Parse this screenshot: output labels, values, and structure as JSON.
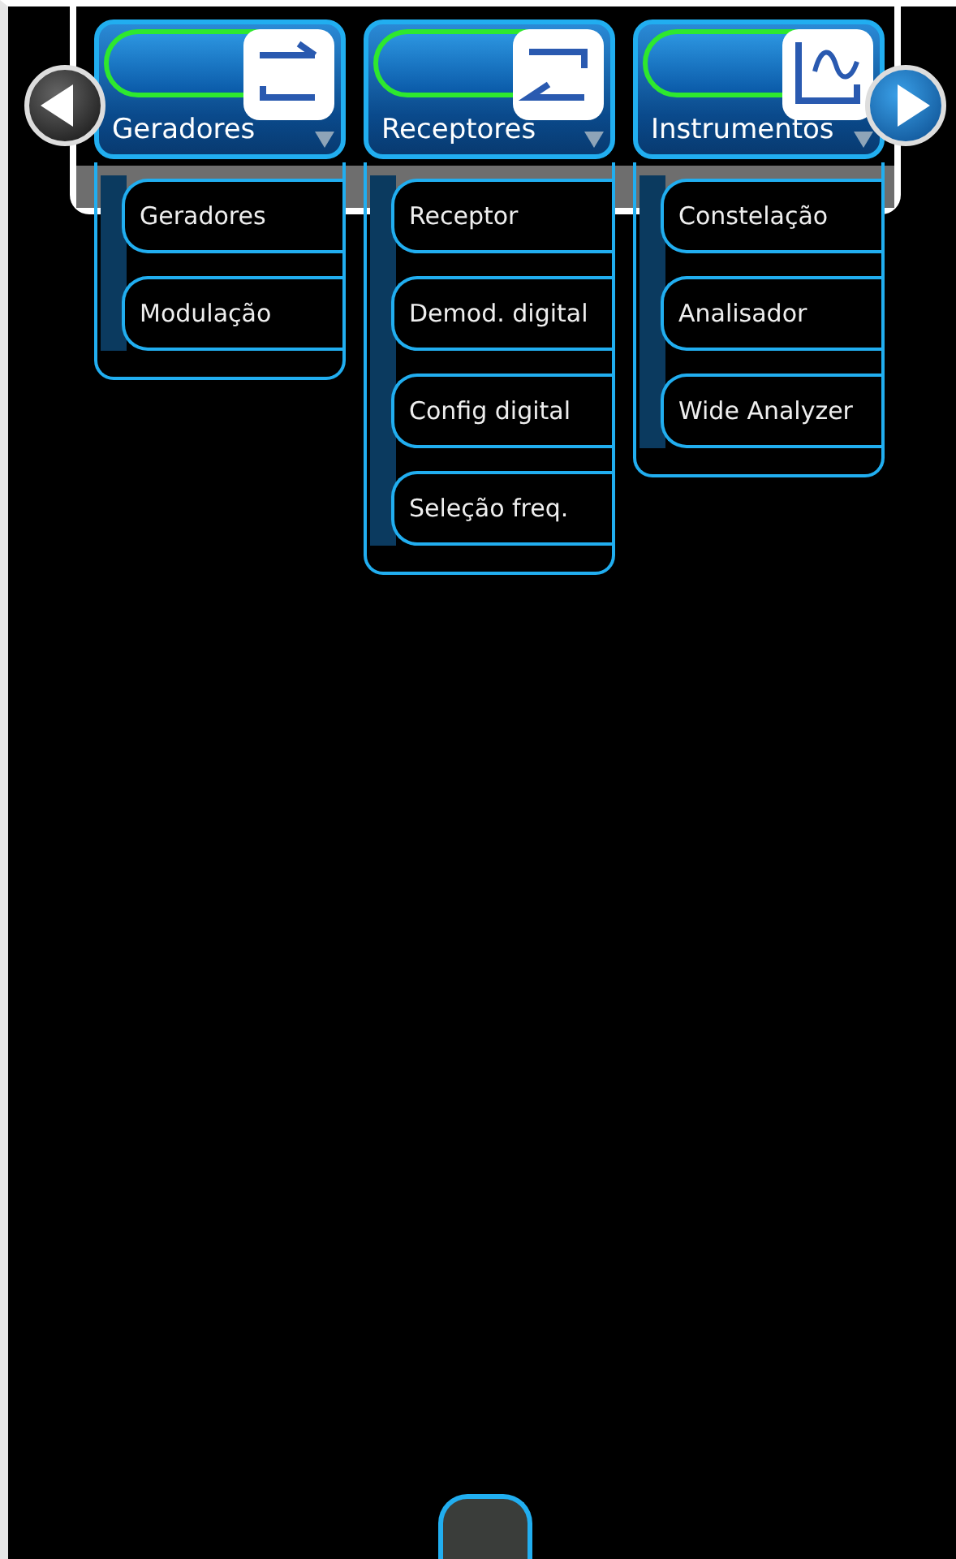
{
  "nav": {
    "previous": {
      "kind": "left"
    },
    "next": {
      "kind": "right"
    }
  },
  "menus": [
    {
      "title": "Geradores",
      "items": [
        "Geradores",
        "Modulação"
      ]
    },
    {
      "title": "Receptores",
      "items": [
        "Receptor",
        "Demod. digital",
        "Config digital",
        "Seleção freq."
      ]
    },
    {
      "title": "Instrumentos",
      "items": [
        "Constelação",
        "Analisador",
        "Wide Analyzer"
      ]
    }
  ],
  "bottom_handle": {
    "kind": "tab"
  }
}
